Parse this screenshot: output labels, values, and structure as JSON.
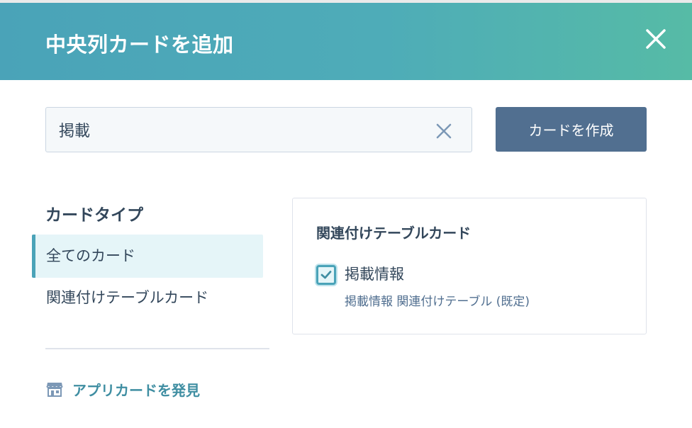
{
  "dialog": {
    "title": "中央列カードを追加",
    "close_icon": "close-icon"
  },
  "search": {
    "value": "掲載",
    "placeholder": "",
    "clear_icon": "x-icon"
  },
  "toolbar": {
    "create_label": "カードを作成"
  },
  "sidebar": {
    "title": "カードタイプ",
    "items": [
      {
        "label": "全てのカード",
        "active": true
      },
      {
        "label": "関連付けテーブルカード",
        "active": false
      }
    ],
    "discover": {
      "label": "アプリカードを発見",
      "icon": "storefront-icon"
    }
  },
  "results": {
    "group_title": "関連付けテーブルカード",
    "items": [
      {
        "label": "掲載情報",
        "description": "掲載情報 関連付けテーブル (既定)",
        "checked": true
      }
    ]
  },
  "colors": {
    "header_start": "#4aa3b8",
    "header_end": "#56bba6",
    "button": "#516f90",
    "accent": "#4aa3b8",
    "link": "#3f8ea2"
  }
}
